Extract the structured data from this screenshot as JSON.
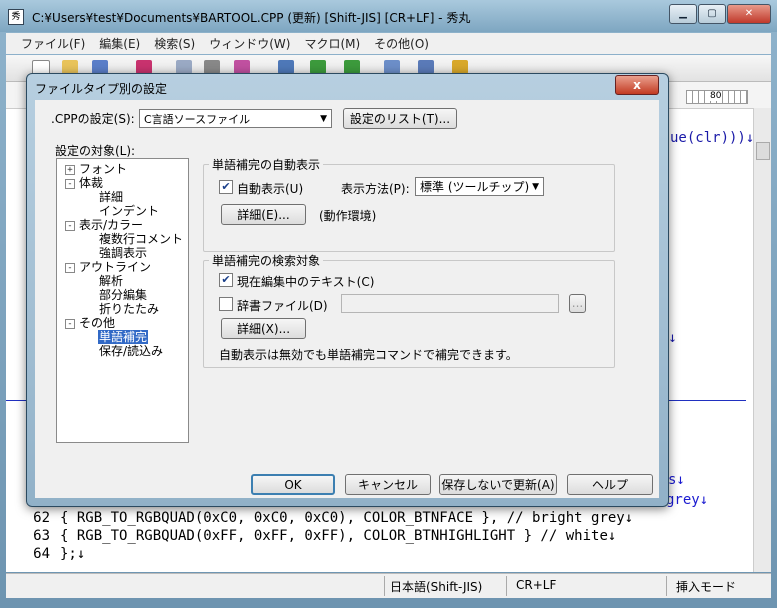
{
  "window": {
    "title": "C:¥Users¥test¥Documents¥BARTOOL.CPP (更新) [Shift-JIS] [CR+LF] - 秀丸",
    "app_icon_text": "秀"
  },
  "menu": [
    "ファイル(F)",
    "編集(E)",
    "検索(S)",
    "ウィンドウ(W)",
    "マクロ(M)",
    "その他(O)"
  ],
  "editor": {
    "ruler_number": "80",
    "right_fragments": [
      {
        "text": "ue(clr)))↓",
        "color": "blue"
      },
      {
        "text": "y↓",
        "color": "blue"
      },
      {
        "text": "s↓",
        "color": "blue"
      },
      {
        "text": "grey↓",
        "color": "comment"
      }
    ],
    "lines": [
      {
        "num": "62",
        "text": "        { RGB_TO_RGBQUAD(0xC0, 0xC0, 0xC0),   COLOR_BTNFACE },       // bright grey↓"
      },
      {
        "num": "63",
        "text": "        { RGB_TO_RGBQUAD(0xFF, 0xFF, 0xFF),   COLOR_BTNHIGHLIGHT }   // white↓"
      },
      {
        "num": "64",
        "text": "    };↓"
      }
    ]
  },
  "statusbar": {
    "encoding": "日本語(Shift-JIS)",
    "newline": "CR+LF",
    "mode": "挿入モード"
  },
  "dialog": {
    "title": "ファイルタイプ別の設定",
    "close_label": "x",
    "cpp_setting_label": ".CPPの設定(S):",
    "cpp_setting_value": "C言語ソースファイル",
    "settings_list_button": "設定のリスト(T)...",
    "target_label": "設定の対象(L):",
    "tree": [
      {
        "label": "フォント",
        "level": 0,
        "box": "+"
      },
      {
        "label": "体裁",
        "level": 0,
        "box": "-"
      },
      {
        "label": "詳細",
        "level": 1
      },
      {
        "label": "インデント",
        "level": 1
      },
      {
        "label": "表示/カラー",
        "level": 0,
        "box": "-"
      },
      {
        "label": "複数行コメント",
        "level": 1
      },
      {
        "label": "強調表示",
        "level": 1
      },
      {
        "label": "アウトライン",
        "level": 0,
        "box": "-"
      },
      {
        "label": "解析",
        "level": 1
      },
      {
        "label": "部分編集",
        "level": 1
      },
      {
        "label": "折りたたみ",
        "level": 1
      },
      {
        "label": "その他",
        "level": 0,
        "box": "-"
      },
      {
        "label": "単語補完",
        "level": 1,
        "selected": true
      },
      {
        "label": "保存/読込み",
        "level": 1
      }
    ],
    "group_auto": {
      "title": "単語補完の自動表示",
      "auto_display_label": "自動表示(U)",
      "auto_display_checked": true,
      "method_label": "表示方法(P):",
      "method_value": "標準 (ツールチップ)",
      "detail_button": "詳細(E)...",
      "detail_note": "(動作環境)"
    },
    "group_search": {
      "title": "単語補完の検索対象",
      "current_text_label": "現在編集中のテキスト(C)",
      "current_text_checked": true,
      "dict_label": "辞書ファイル(D)",
      "dict_checked": false,
      "browse_label": "...",
      "detail_button": "詳細(X)...",
      "note": "自動表示は無効でも単語補完コマンドで補完できます。"
    },
    "buttons": {
      "ok": "OK",
      "cancel": "キャンセル",
      "update_nosave": "保存しないで更新(A)",
      "help": "ヘルプ"
    }
  }
}
